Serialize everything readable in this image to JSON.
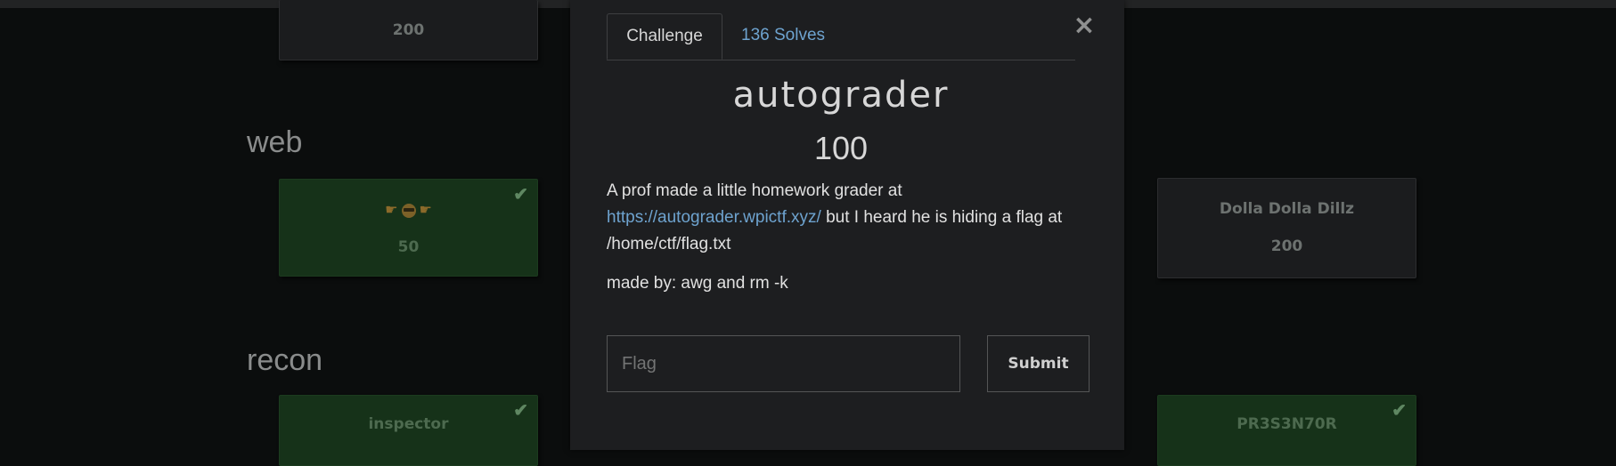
{
  "board": {
    "top_card": {
      "value": "200"
    },
    "categories": [
      {
        "name": "web"
      },
      {
        "name": "recon"
      }
    ],
    "web_cards": [
      {
        "value": "50",
        "solved": true
      },
      {
        "name": "Dolla Dolla Dillz",
        "value": "200",
        "solved": false
      }
    ],
    "recon_cards": [
      {
        "name": "inspector",
        "solved": true
      },
      {
        "name": "PR3S3N70R",
        "solved": true
      }
    ],
    "check_icon": "checkmark-icon",
    "emoji_icons": [
      "pointing-hand-icon",
      "sunglasses-face-icon",
      "pointing-hand-icon"
    ]
  },
  "modal": {
    "tabs": [
      {
        "label": "Challenge",
        "active": true
      },
      {
        "label": "136 Solves",
        "active": false
      }
    ],
    "close_label": "×",
    "title": "autograder",
    "value": "100",
    "description_before": "A prof made a little homework grader at ",
    "description_link": "https://autograder.wpictf.xyz/",
    "description_after": " but I heard he is hiding a flag at /home/ctf/flag.txt",
    "author": "made by: awg and rm -k",
    "flag_placeholder": "Flag",
    "submit_label": "Submit"
  },
  "colors": {
    "background": "#0b0d0d",
    "modal_bg": "#1d1e20",
    "solved_card": "#163219",
    "link": "#6ea3cf"
  }
}
